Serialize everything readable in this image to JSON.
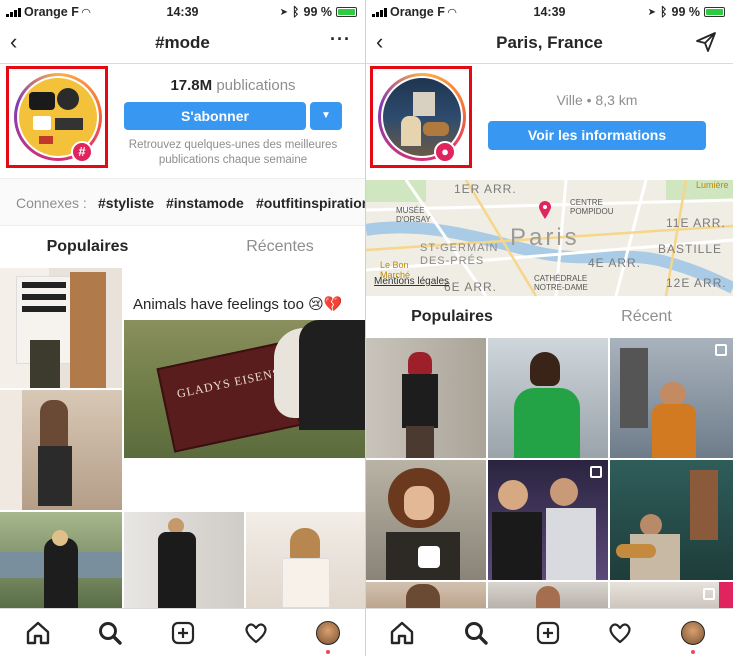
{
  "left": {
    "status": {
      "carrier": "Orange F",
      "time": "14:39",
      "battery": "99 %"
    },
    "header": {
      "title": "#mode"
    },
    "stats": {
      "count": "17.8M",
      "count_label": "publications"
    },
    "follow_label": "S'abonner",
    "description": "Retrouvez quelques-unes des meilleures publications chaque semaine",
    "related": {
      "label": "Connexes :",
      "tags": [
        "#styliste",
        "#instamode",
        "#outfitinspiration"
      ]
    },
    "tabs": [
      "Populaires",
      "Récentes"
    ],
    "post_caption": "Animals have feelings too 😢💔",
    "grave_text": "GLADYS EISENS"
  },
  "right": {
    "status": {
      "carrier": "Orange F",
      "time": "14:39",
      "battery": "99 %"
    },
    "header": {
      "title": "Paris, France"
    },
    "place_info": "Ville • 8,3 km",
    "info_button": "Voir les informations",
    "map": {
      "labels": [
        "1ER ARR.",
        "CENTRE POMPIDOU",
        "MUSÉE D'ORSAY",
        "11E ARR.",
        "Paris",
        "ST-GERMAIN DES-PRÉS",
        "BASTILLE",
        "4E ARR.",
        "Le Bon Marché",
        "6E ARR.",
        "CATHÉDRALE NOTRE-DAME",
        "12E ARR.",
        "Lumière"
      ],
      "legal": "Mentions légales"
    },
    "tabs": [
      "Populaires",
      "Récent"
    ]
  },
  "colors": {
    "accent": "#3897f0",
    "highlight": "#e50914",
    "badge": "#e0245e"
  }
}
